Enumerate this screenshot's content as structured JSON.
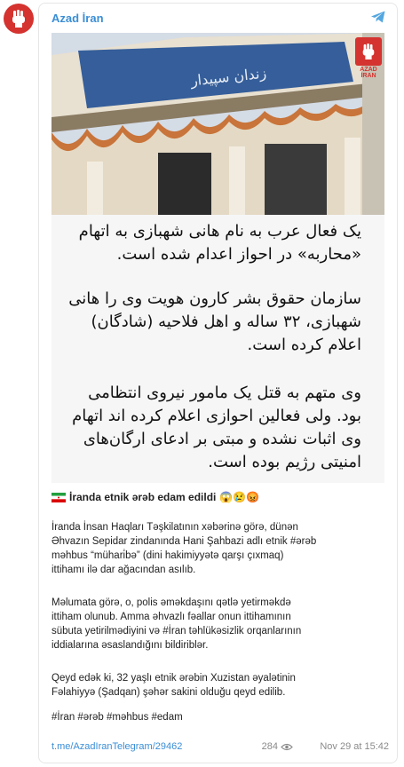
{
  "channel": {
    "name": "Azad İran",
    "logo_text": "AZAD İRAN"
  },
  "persian_text": {
    "p1": [
      "یک فعال عرب به نام هانی شهبازی به اتهام",
      "«محاربه» در احواز اعدام شده است."
    ],
    "p2": [
      "سازمان حقوق بشر کارون هویت وی را هانی",
      "شهبازی، ۳۲ ساله و اهل فلاحیه (شادگان)",
      "اعلام کرده است."
    ],
    "p3": [
      "وی متهم به قتل یک مامور نیروی انتظامی",
      "بود. ولی فعالین احوازی اعلام کرده اند اتهام",
      "وی اثبات نشده و مبتی بر ادعای ارگان‌های",
      "امنیتی رژیم بوده است."
    ]
  },
  "post": {
    "headline": "İranda etnik ərəb edam edildi",
    "headline_emojis": "😱😢😡",
    "p1": [
      "İranda İnsan Haqları Təşkilatının xəbərinə görə, dünən",
      "Əhvazın Sepidar zindanında Hani Şahbazi adlı etnik #ərəb",
      "məhbus “mühari̇bə” (dini hakimiyyətə qarşı çıxmaq)",
      "ittihamı ilə dar ağacından asılıb."
    ],
    "p2": [
      "Məlumata görə, o, polis əməkdaşını qətlə yetirməkdə",
      "ittiham olunub. Amma əhvazlı fəallar onun ittihamının",
      "sübuta yetirilmədiyini və #İran təhlükəsizlik orqanlarının",
      "iddialarına əsaslandığını bildiriblər."
    ],
    "p3": [
      "Qeyd edək ki, 32 yaşlı etnik ərəbin Xuzistan əyalətinin",
      "Fəlahiyyə (Şadqan) şəhər sakini olduğu qeyd edilib."
    ],
    "hashtags": "#İran #ərəb #məhbus #edam",
    "link": "t.me/AzadIranTelegram/29462",
    "views": "284",
    "timestamp": "Nov 29 at 15:42"
  },
  "colors": {
    "accent": "#3a8ed6",
    "brand_red": "#d4332f"
  },
  "icons": [
    "avatar-fist-logo",
    "telegram-icon",
    "eye-icon",
    "iran-flag-icon"
  ]
}
